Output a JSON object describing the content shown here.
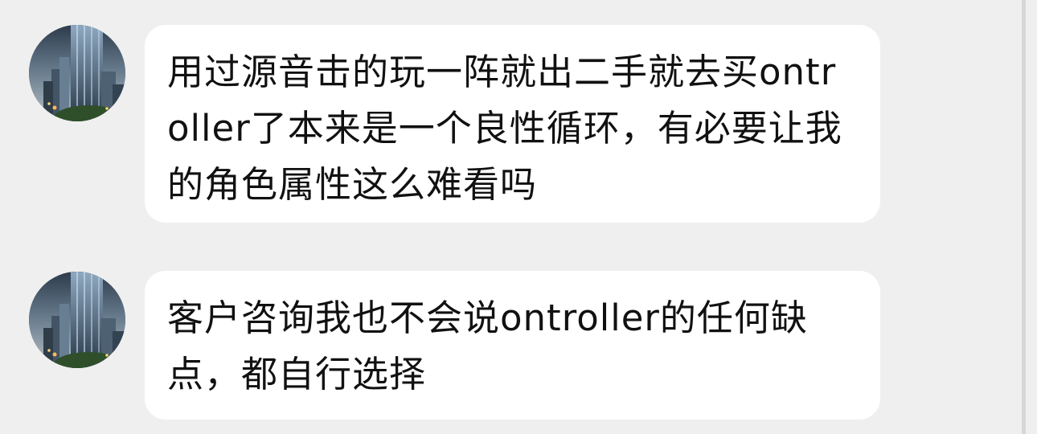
{
  "messages": [
    {
      "sender_avatar": "city-skyline-avatar",
      "text": "用过源音击的玩一阵就出二手就去买ontroller了本来是一个良性循环，有必要让我的角色属性这么难看吗"
    },
    {
      "sender_avatar": "city-skyline-avatar",
      "text": "客户咨询我也不会说ontroller的任何缺点，都自行选择"
    }
  ],
  "colors": {
    "background": "#efefef",
    "bubble": "#ffffff",
    "text": "#111111",
    "scrollbar": "#d7d7d7"
  }
}
